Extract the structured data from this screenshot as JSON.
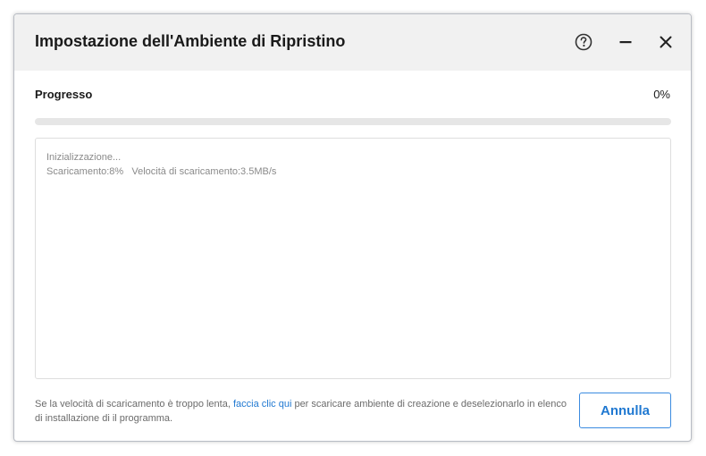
{
  "dialog": {
    "title": "Impostazione dell'Ambiente di Ripristino",
    "icons": {
      "help": "help-circle-icon",
      "minimize": "minimize-icon",
      "close": "close-icon"
    }
  },
  "progress": {
    "label": "Progresso",
    "percent_text": "0%",
    "fraction": 0
  },
  "log": {
    "lines": [
      "Inizializzazione...",
      "Scaricamento:8%   Velocità di scaricamento:3.5MB/s"
    ]
  },
  "footer": {
    "text_before": "Se la velocità di scaricamento è troppo lenta, ",
    "link": "faccia clic qui",
    "text_after": " per scaricare ambiente di creazione e deselezionarlo in elenco di installazione di il programma."
  },
  "buttons": {
    "cancel": "Annulla"
  },
  "colors": {
    "accent": "#1f78d1",
    "titlebar": "#f1f1f1",
    "track": "#e6e6e6"
  }
}
